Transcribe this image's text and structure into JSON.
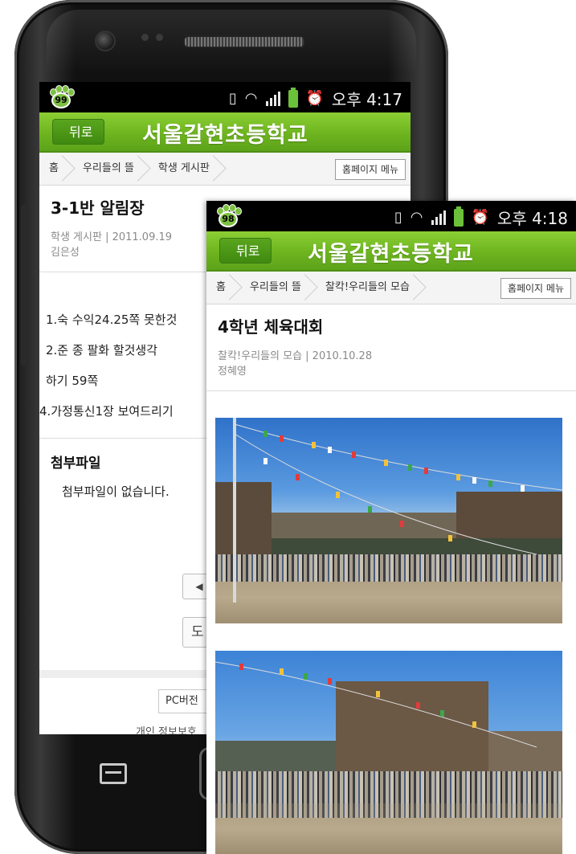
{
  "screen_a": {
    "status": {
      "badge": "99",
      "time": "오후 4:17"
    },
    "header": {
      "back": "뒤로",
      "title": "서울갈현초등학교"
    },
    "breadcrumb": {
      "items": [
        "홈",
        "우리들의 뜰",
        "학생 게시판"
      ],
      "menu": "홈페이지 메뉴"
    },
    "post": {
      "title": "3-1반 알림장",
      "meta": "학생 게시판 | 2011.09.19",
      "author": "김은성",
      "lines": [
        "1.숙 수익24.25쪽 못한것",
        "2.준 종 팔화 할것생각",
        "하기 59쪽",
        "4.가정통신1장 보여드리기"
      ]
    },
    "attachments": {
      "heading": "첨부파일",
      "empty": "첨부파일이 없습니다."
    },
    "buttons": {
      "prev_arrow": "◀",
      "list_partial": "도"
    },
    "footer": {
      "pc": "PC버전",
      "privacy": "개인 정보보호"
    }
  },
  "screen_b": {
    "status": {
      "badge": "98",
      "time": "오후 4:18"
    },
    "header": {
      "back": "뒤로",
      "title": "서울갈현초등학교"
    },
    "breadcrumb": {
      "items": [
        "홈",
        "우리들의 뜰",
        "찰칵!우리들의 모습"
      ],
      "menu": "홈페이지 메뉴"
    },
    "post": {
      "title": "4학년 체육대회",
      "meta": "찰칵!우리들의 모습 | 2010.10.28",
      "author": "정혜영"
    }
  },
  "colors": {
    "header_green": "#6db41f",
    "status_bg": "#000000",
    "accent_green": "#7dc142"
  },
  "icons": [
    "paw-badge-icon",
    "vibrate-icon",
    "wifi-icon",
    "signal-icon",
    "battery-icon",
    "alarm-icon"
  ]
}
